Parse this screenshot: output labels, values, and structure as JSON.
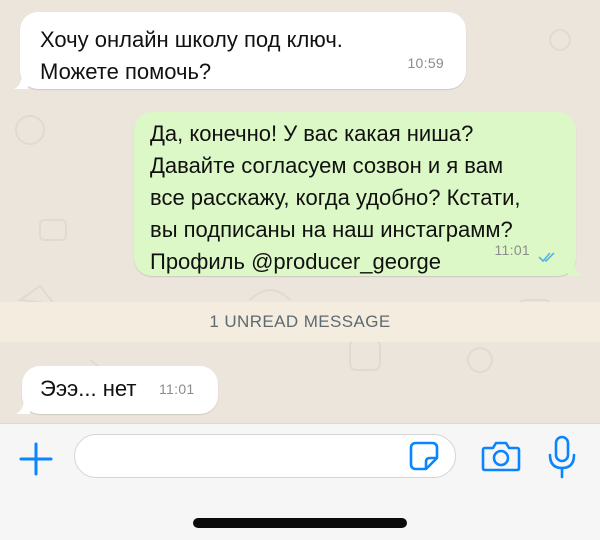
{
  "messages": [
    {
      "direction": "incoming",
      "text": "Хочу онлайн школу под ключ.\nМожете помочь?",
      "time": "10:59"
    },
    {
      "direction": "outgoing",
      "text": "Да, конечно! У вас какая ниша?\nДавайте согласуем созвон и я вам\nвсе расскажу, когда удобно? Кстати,\nвы подписаны на наш инстаграмм?\nПрофиль @producer_george",
      "time": "11:01",
      "status": "read"
    },
    {
      "direction": "incoming",
      "text": "Эээ... нет",
      "time": "11:01"
    }
  ],
  "unread_banner": "1 UNREAD MESSAGE",
  "composer": {
    "placeholder": "",
    "icons": [
      "plus-icon",
      "sticker-icon",
      "camera-icon",
      "microphone-icon"
    ]
  },
  "colors": {
    "accent": "#0a84ff",
    "outgoing_bubble": "#dcf8c6",
    "incoming_bubble": "#ffffff",
    "chat_background": "#ebe5dc",
    "read_ticks": "#4fb6ec"
  }
}
